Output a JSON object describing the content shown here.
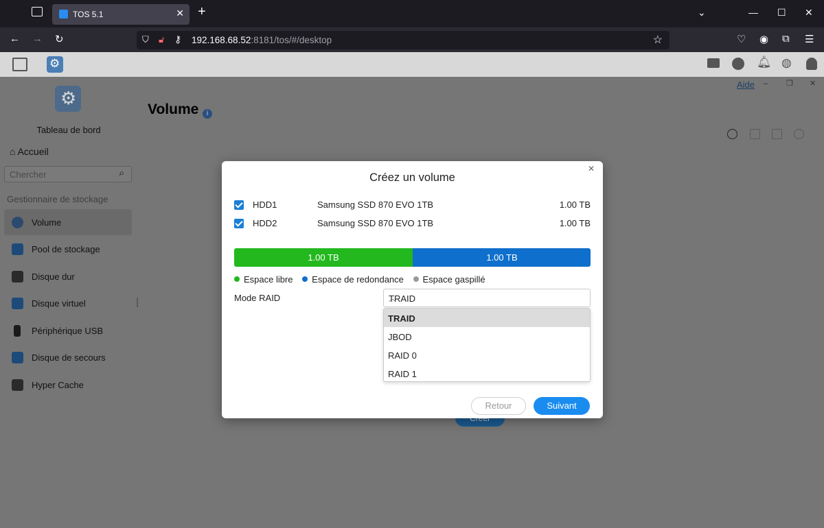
{
  "browser": {
    "tab_title": "TOS 5.1",
    "url_host": "192.168.68.52",
    "url_rest": ":8181/tos/#/desktop"
  },
  "window_header": {
    "help_link": "Aide"
  },
  "sidebar": {
    "app_title": "Tableau de bord",
    "home_label": "Accueil",
    "search_placeholder": "Chercher",
    "section_label": "Gestionnaire de stockage",
    "items": [
      {
        "label": "Volume"
      },
      {
        "label": "Pool de stockage"
      },
      {
        "label": "Disque dur"
      },
      {
        "label": "Disque virtuel"
      },
      {
        "label": "Périphérique USB"
      },
      {
        "label": "Disque de secours"
      },
      {
        "label": "Hyper Cache"
      }
    ]
  },
  "main": {
    "title": "Volume",
    "background_button": "Créer"
  },
  "modal": {
    "title": "Créez un volume",
    "disks": [
      {
        "name": "HDD1",
        "model": "Samsung SSD 870 EVO 1TB",
        "size": "1.00 TB",
        "checked": true
      },
      {
        "name": "HDD2",
        "model": "Samsung SSD 870 EVO 1TB",
        "size": "1.00 TB",
        "checked": true
      }
    ],
    "capacity_bar": {
      "free": "1.00 TB",
      "redundancy": "1.00 TB",
      "free_fraction": 0.5,
      "redundancy_fraction": 0.5
    },
    "legend": {
      "free": "Espace libre",
      "redundancy": "Espace de redondance",
      "wasted": "Espace gaspillé"
    },
    "raid_label": "Mode RAID",
    "raid_selected": "TRAID",
    "raid_options": [
      "TRAID",
      "JBOD",
      "RAID 0",
      "RAID 1"
    ],
    "back_button": "Retour",
    "next_button": "Suivant"
  },
  "colors": {
    "free": "#22b81e",
    "redundancy": "#0f6fcc",
    "wasted": "#9a9a9a",
    "primary": "#1a8cf0"
  }
}
